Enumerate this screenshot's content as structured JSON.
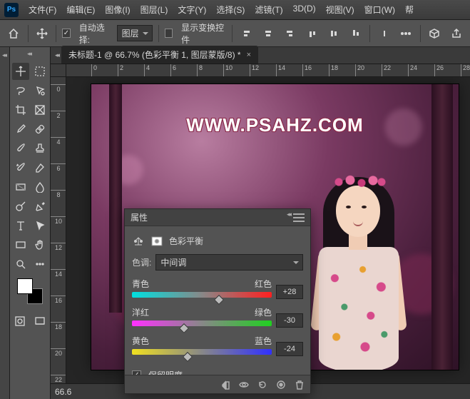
{
  "app": {
    "badge": "Ps"
  },
  "menu": [
    "文件(F)",
    "编辑(E)",
    "图像(I)",
    "图层(L)",
    "文字(Y)",
    "选择(S)",
    "滤镜(T)",
    "3D(D)",
    "视图(V)",
    "窗口(W)",
    "帮"
  ],
  "options": {
    "auto_select_label": "自动选择:",
    "auto_select_value": "图层",
    "show_transform_label": "显示变换控件"
  },
  "document": {
    "tab_title": "未标题-1 @ 66.7% (色彩平衡 1, 图层蒙版/8) *",
    "zoom": "66.6",
    "watermark": "WWW.PSAHZ.COM"
  },
  "ruler_h": [
    0,
    2,
    4,
    6,
    8,
    10,
    12,
    14,
    16,
    18,
    20,
    22,
    24,
    26,
    28
  ],
  "ruler_v": [
    0,
    2,
    4,
    6,
    8,
    10,
    12,
    14,
    16,
    18,
    20,
    22
  ],
  "panel": {
    "title": "属性",
    "type_label": "色彩平衡",
    "tone_label": "色调:",
    "tone_value": "中间调",
    "sliders": [
      {
        "left": "青色",
        "right": "红色",
        "value": "+28",
        "pos": 62,
        "grad": "g-cr"
      },
      {
        "left": "洋红",
        "right": "绿色",
        "value": "-30",
        "pos": 37,
        "grad": "g-mg"
      },
      {
        "left": "黄色",
        "right": "蓝色",
        "value": "-24",
        "pos": 40,
        "grad": "g-yb"
      }
    ],
    "preserve_label": "保留明度",
    "preserve_checked": true
  }
}
